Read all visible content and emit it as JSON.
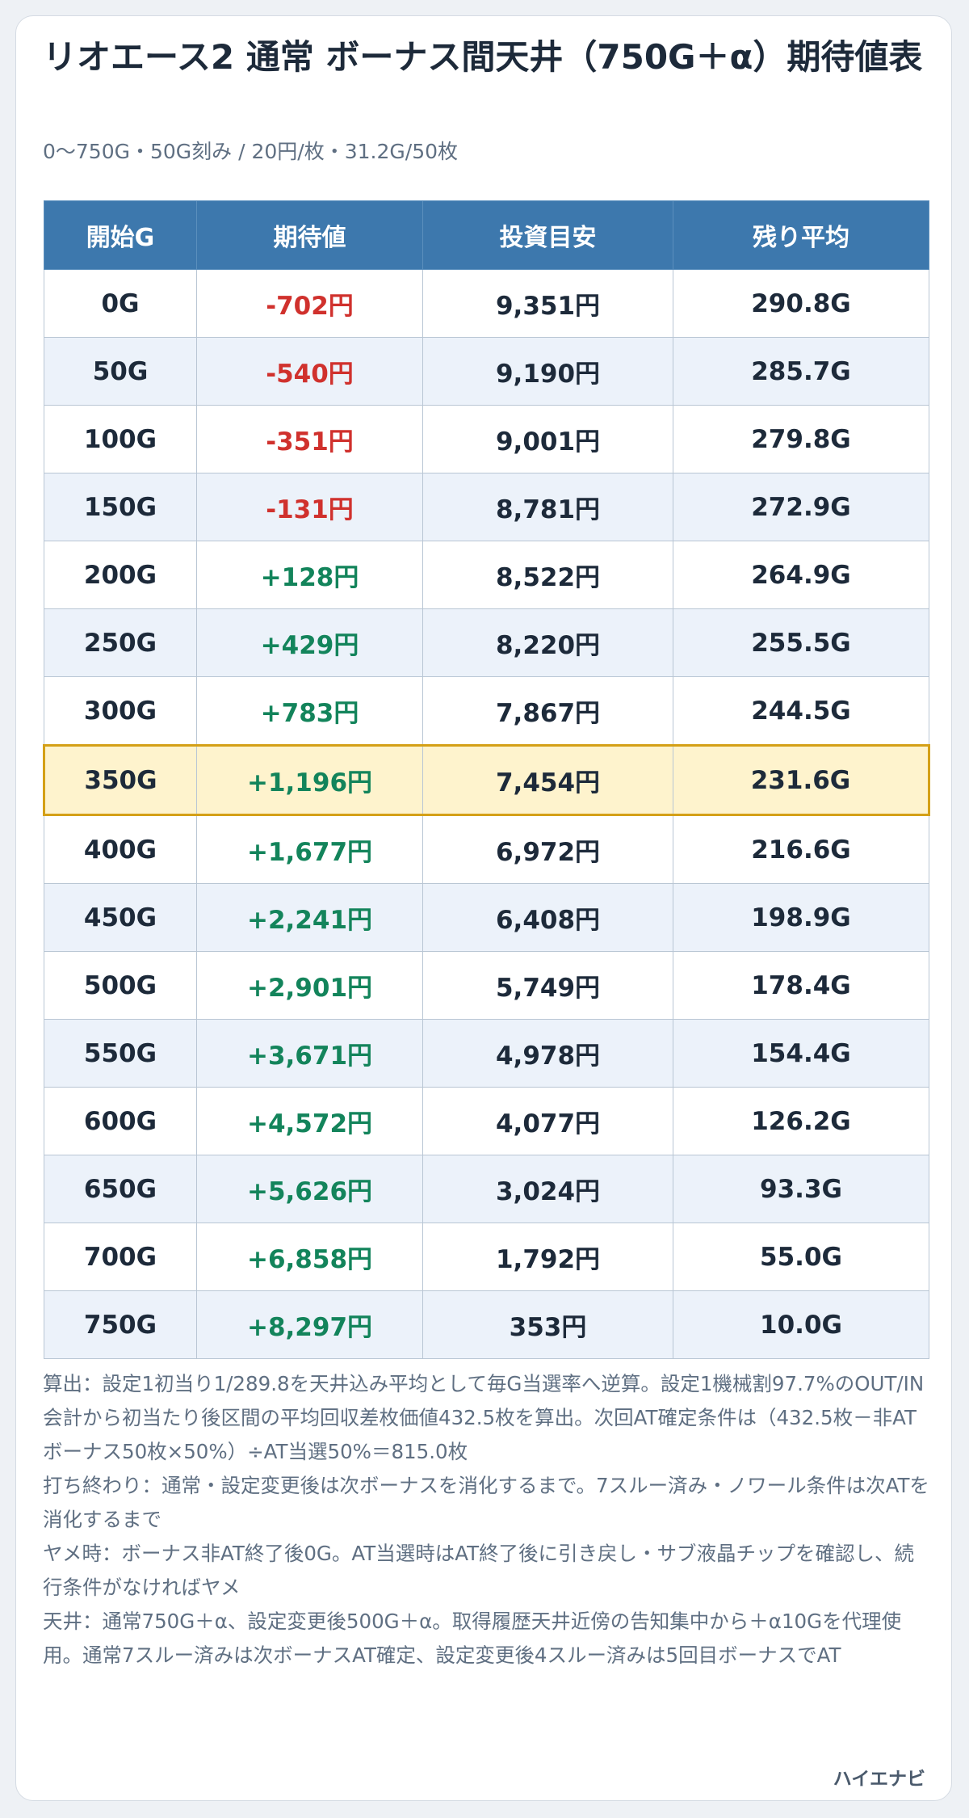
{
  "title": "リオエース2 通常 ボーナス間天井（750G＋α）期待値表",
  "subtitle": "0〜750G・50G刻み / 20円/枚・31.2G/50枚",
  "table": {
    "headers": [
      "開始G",
      "期待値",
      "投資目安",
      "残り平均"
    ],
    "highlight_start": "350G",
    "rows": [
      {
        "start": "0G",
        "ev": "-702円",
        "ev_sign": "neg",
        "invest": "9,351円",
        "remaining": "290.8G"
      },
      {
        "start": "50G",
        "ev": "-540円",
        "ev_sign": "neg",
        "invest": "9,190円",
        "remaining": "285.7G"
      },
      {
        "start": "100G",
        "ev": "-351円",
        "ev_sign": "neg",
        "invest": "9,001円",
        "remaining": "279.8G"
      },
      {
        "start": "150G",
        "ev": "-131円",
        "ev_sign": "neg",
        "invest": "8,781円",
        "remaining": "272.9G"
      },
      {
        "start": "200G",
        "ev": "+128円",
        "ev_sign": "pos",
        "invest": "8,522円",
        "remaining": "264.9G"
      },
      {
        "start": "250G",
        "ev": "+429円",
        "ev_sign": "pos",
        "invest": "8,220円",
        "remaining": "255.5G"
      },
      {
        "start": "300G",
        "ev": "+783円",
        "ev_sign": "pos",
        "invest": "7,867円",
        "remaining": "244.5G"
      },
      {
        "start": "350G",
        "ev": "+1,196円",
        "ev_sign": "pos",
        "invest": "7,454円",
        "remaining": "231.6G"
      },
      {
        "start": "400G",
        "ev": "+1,677円",
        "ev_sign": "pos",
        "invest": "6,972円",
        "remaining": "216.6G"
      },
      {
        "start": "450G",
        "ev": "+2,241円",
        "ev_sign": "pos",
        "invest": "6,408円",
        "remaining": "198.9G"
      },
      {
        "start": "500G",
        "ev": "+2,901円",
        "ev_sign": "pos",
        "invest": "5,749円",
        "remaining": "178.4G"
      },
      {
        "start": "550G",
        "ev": "+3,671円",
        "ev_sign": "pos",
        "invest": "4,978円",
        "remaining": "154.4G"
      },
      {
        "start": "600G",
        "ev": "+4,572円",
        "ev_sign": "pos",
        "invest": "4,077円",
        "remaining": "126.2G"
      },
      {
        "start": "650G",
        "ev": "+5,626円",
        "ev_sign": "pos",
        "invest": "3,024円",
        "remaining": "93.3G"
      },
      {
        "start": "700G",
        "ev": "+6,858円",
        "ev_sign": "pos",
        "invest": "1,792円",
        "remaining": "55.0G"
      },
      {
        "start": "750G",
        "ev": "+8,297円",
        "ev_sign": "pos",
        "invest": "353円",
        "remaining": "10.0G"
      }
    ]
  },
  "notes": [
    "算出：設定1初当り1/289.8を天井込み平均として毎G当選率へ逆算。設定1機械割97.7%のOUT/IN会計から初当たり後区間の平均回収差枚価値432.5枚を算出。次回AT確定条件は（432.5枚－非ATボーナス50枚×50%）÷AT当選50%＝815.0枚",
    "打ち終わり：通常・設定変更後は次ボーナスを消化するまで。7スルー済み・ノワール条件は次ATを消化するまで",
    "ヤメ時：ボーナス非AT終了後0G。AT当選時はAT終了後に引き戻し・サブ液晶チップを確認し、続行条件がなければヤメ",
    "天井：通常750G＋α、設定変更後500G＋α。取得履歴天井近傍の告知集中から＋α10Gを代理使用。通常7スルー済みは次ボーナスAT確定、設定変更後4スルー済みは5回目ボーナスでAT"
  ],
  "brand": "ハイエナビ",
  "colors": {
    "header_bg": "#3d78ad",
    "negative": "#d0312d",
    "positive": "#13845b",
    "highlight_bg": "#fef3cd",
    "highlight_border": "#d4a017"
  }
}
